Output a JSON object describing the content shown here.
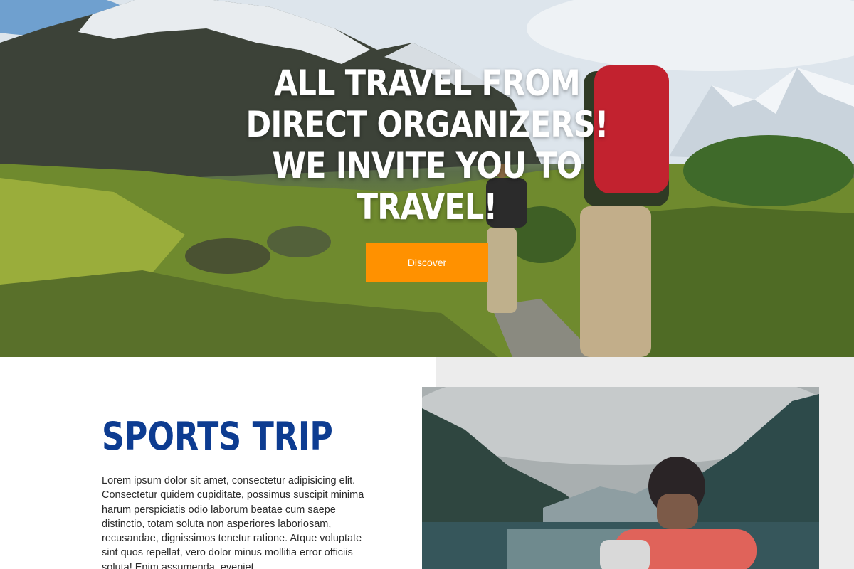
{
  "hero": {
    "title_lines": [
      "ALL TRAVEL FROM",
      "DIRECT ORGANIZERS!",
      "WE INVITE YOU TO",
      "TRAVEL!"
    ],
    "button_label": "Discover",
    "button_color": "#ff9100"
  },
  "section": {
    "title": "SPORTS TRIP",
    "title_color": "#0d3c91",
    "text": "Lorem ipsum dolor sit amet, consectetur adipisicing elit. Consectetur quidem cupiditate, possimus suscipit minima harum perspiciatis odio laborum beatae cum saepe distinctio, totam soluta non asperiores laboriosam, recusandae, dignissimos tenetur ratione. Atque voluptate sint quos repellat, vero dolor minus mollitia error officiis soluta! Enim assumenda, eveniet"
  }
}
